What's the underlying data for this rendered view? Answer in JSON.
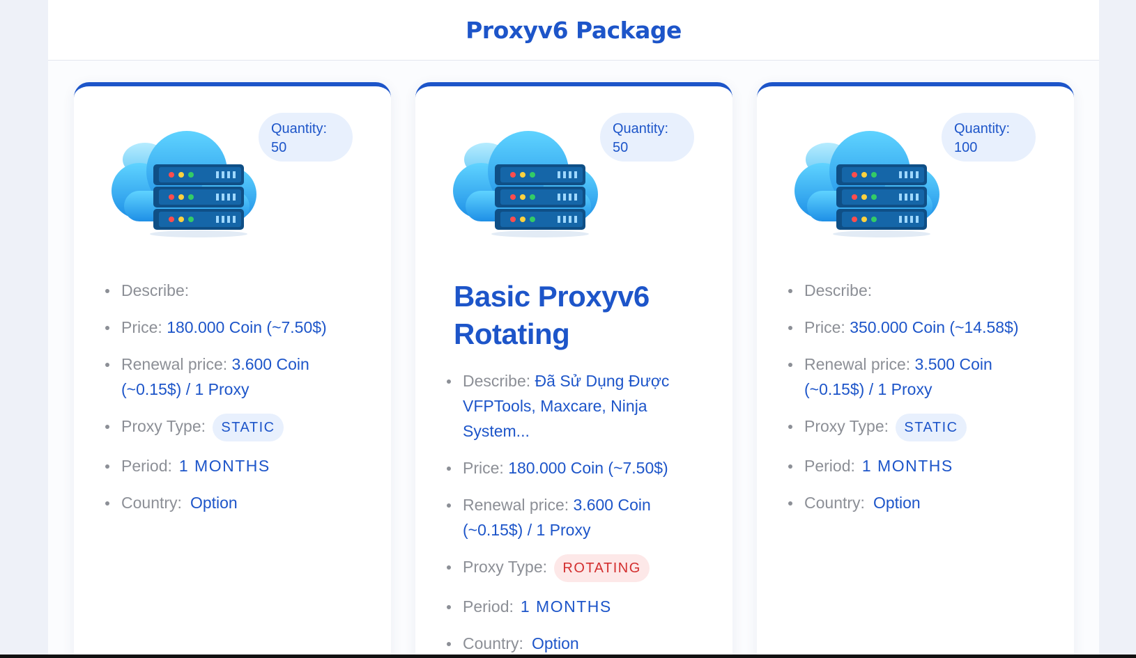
{
  "page": {
    "title": "Proxyv6 Package"
  },
  "labels": {
    "quantity": "Quantity:",
    "describe": "Describe:",
    "price": "Price:",
    "renewal_price": "Renewal price:",
    "proxy_type": "Proxy Type:",
    "period": "Period:",
    "country": "Country:"
  },
  "cards": [
    {
      "quantity": "50",
      "title": "",
      "describe": "",
      "price": "180.000 Coin (~7.50$)",
      "renewal_price": "3.600 Coin (~0.15$) / 1 Proxy",
      "proxy_type": "STATIC",
      "period": "1 MONTHS",
      "country": "Option"
    },
    {
      "quantity": "50",
      "title": "Basic Proxyv6 Rotating",
      "describe": "Đã Sử Dụng Được VFPTools, Maxcare, Ninja System...",
      "price": "180.000 Coin (~7.50$)",
      "renewal_price": "3.600 Coin (~0.15$) / 1 Proxy",
      "proxy_type": "ROTATING",
      "period": "1 MONTHS",
      "country": "Option"
    },
    {
      "quantity": "100",
      "title": "",
      "describe": "",
      "price": "350.000 Coin (~14.58$)",
      "renewal_price": "3.500 Coin (~0.15$) / 1 Proxy",
      "proxy_type": "STATIC",
      "period": "1 MONTHS",
      "country": "Option"
    }
  ],
  "colors": {
    "primary": "#1d55c9",
    "muted_text": "#8c8f96",
    "static_badge_bg": "#e8f0fd",
    "rotating_badge_bg": "#fde8e8",
    "rotating_badge_text": "#d32f2f"
  },
  "icons": {
    "package_image": "cloud-server-icon"
  }
}
